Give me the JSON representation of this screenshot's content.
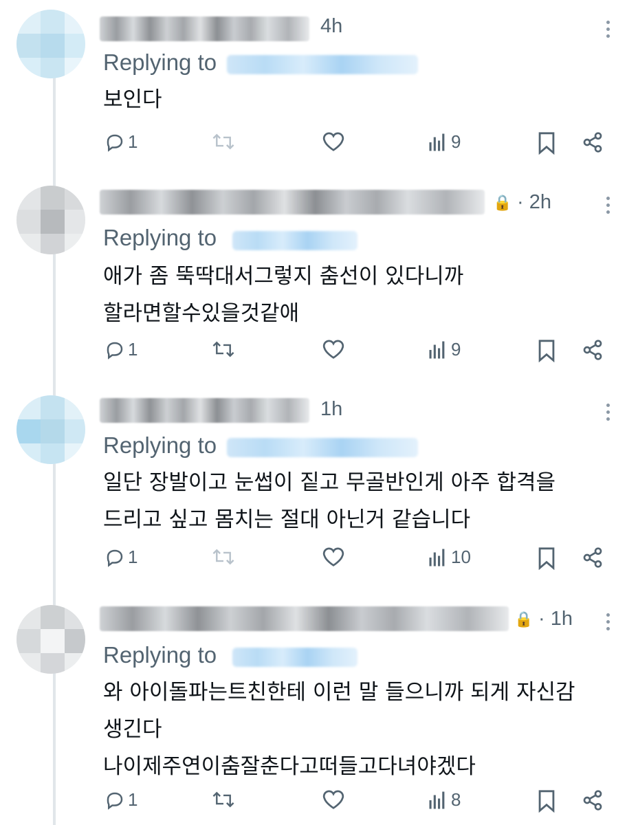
{
  "reply_label": "Replying to",
  "tweets": [
    {
      "time": "4h",
      "locked": false,
      "text": [
        "보인다"
      ],
      "replies": "1",
      "retweets": "",
      "views": "9"
    },
    {
      "time": "· 2h",
      "locked": true,
      "text": [
        "애가 좀 뚝딱대서그렇지 춤선이 있다니까",
        "할라면할수있을것같애"
      ],
      "replies": "1",
      "retweets": "",
      "views": "9"
    },
    {
      "time": "1h",
      "locked": false,
      "text": [
        "일단 장발이고 눈썹이 짙고 무골반인게 아주 합격을",
        "드리고 싶고 몸치는 절대 아닌거 같습니다"
      ],
      "replies": "1",
      "retweets": "",
      "views": "10"
    },
    {
      "time": "· 1h",
      "locked": true,
      "text": [
        "와 아이돌파는트친한테 이런 말 들으니까 되게 자신감",
        "생긴다",
        "나이제주연이춤잘춘다고떠들고다녀야겠다"
      ],
      "replies": "1",
      "retweets": "",
      "views": "8"
    }
  ],
  "icons": {
    "reply": "reply-icon",
    "retweet": "retweet-icon",
    "like": "heart-icon",
    "views": "views-icon",
    "bookmark": "bookmark-icon",
    "share": "share-icon",
    "more": "more-icon",
    "lock": "lock-icon"
  },
  "colors": {
    "text": "#0f1419",
    "muted": "#536471",
    "background": "#ffffff"
  }
}
